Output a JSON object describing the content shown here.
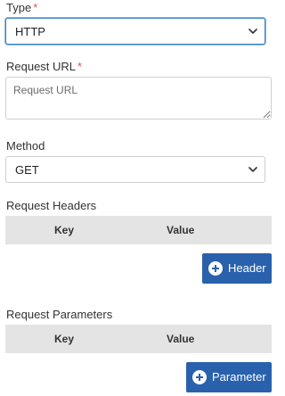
{
  "form": {
    "type": {
      "label": "Type",
      "required_mark": "*",
      "value": "HTTP"
    },
    "request_url": {
      "label": "Request URL",
      "required_mark": "*",
      "placeholder": "Request URL",
      "value": ""
    },
    "method": {
      "label": "Method",
      "value": "GET"
    },
    "request_headers": {
      "label": "Request Headers",
      "columns": [
        "Key",
        "Value"
      ],
      "add_button_label": "Header"
    },
    "request_parameters": {
      "label": "Request Parameters",
      "columns": [
        "Key",
        "Value"
      ],
      "add_button_label": "Parameter"
    }
  },
  "colors": {
    "primary_button": "#2961ad",
    "required_mark": "#d9534f",
    "focus_border": "#3b82c4",
    "table_header_bg": "#e4e4e4"
  },
  "icons": {
    "dropdown": "chevron-down-icon",
    "add": "plus-circle-icon"
  }
}
